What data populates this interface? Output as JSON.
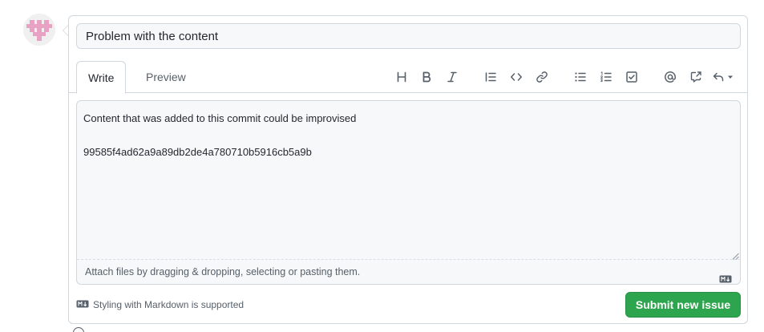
{
  "issue": {
    "title_value": "Problem with the content",
    "body_text": "Content that was added to this commit could be improvised\n\n99585f4ad62a9a89db2de4a780710b5916cb5a9b"
  },
  "tabs": [
    {
      "label": "Write",
      "active": true
    },
    {
      "label": "Preview",
      "active": false
    }
  ],
  "toolbar": {
    "icons": [
      "heading-icon",
      "bold-icon",
      "italic-icon",
      "quote-icon",
      "code-icon",
      "link-icon",
      "bulleted-list-icon",
      "numbered-list-icon",
      "task-list-icon",
      "mention-icon",
      "reference-icon",
      "reply-icon"
    ]
  },
  "editor": {
    "attach_hint": "Attach files by dragging & dropping, selecting or pasting them."
  },
  "footer": {
    "markdown_note": "Styling with Markdown is supported",
    "submit_label": "Submit new issue"
  },
  "colors": {
    "accent_green": "#2da44e",
    "border": "#d0d7de",
    "muted_text": "#57606a",
    "avatar_pink": "#e8a3c4"
  }
}
